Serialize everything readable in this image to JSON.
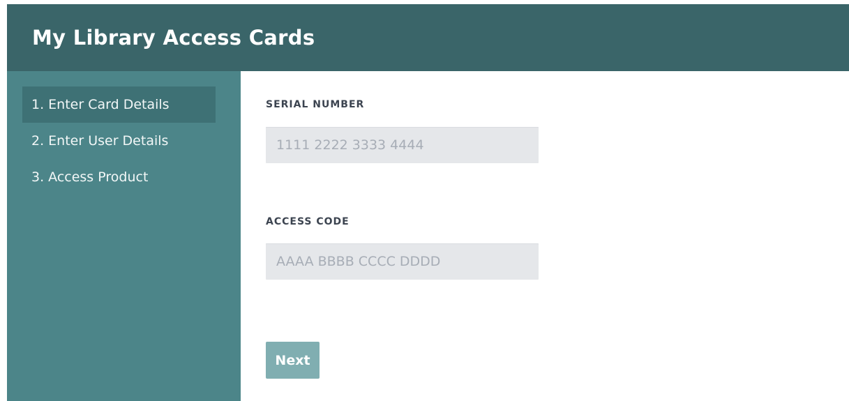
{
  "header": {
    "title": "My Library Access Cards"
  },
  "sidebar": {
    "steps": [
      {
        "label": "1. Enter Card Details",
        "active": true
      },
      {
        "label": "2. Enter User Details",
        "active": false
      },
      {
        "label": "3. Access Product",
        "active": false
      }
    ]
  },
  "form": {
    "serial": {
      "label": "SERIAL NUMBER",
      "value": "",
      "placeholder": "1111 2222 3333 4444"
    },
    "access": {
      "label": "ACCESS CODE",
      "value": "",
      "placeholder": "AAAA BBBB CCCC DDDD"
    },
    "next_label": "Next"
  },
  "colors": {
    "header_bg": "#3a6569",
    "sidebar_bg": "#4c8589",
    "active_step_bg": "#3e7175",
    "input_bg": "#e5e7ea",
    "button_bg": "#80aeb1",
    "label_text": "#3c4450"
  }
}
